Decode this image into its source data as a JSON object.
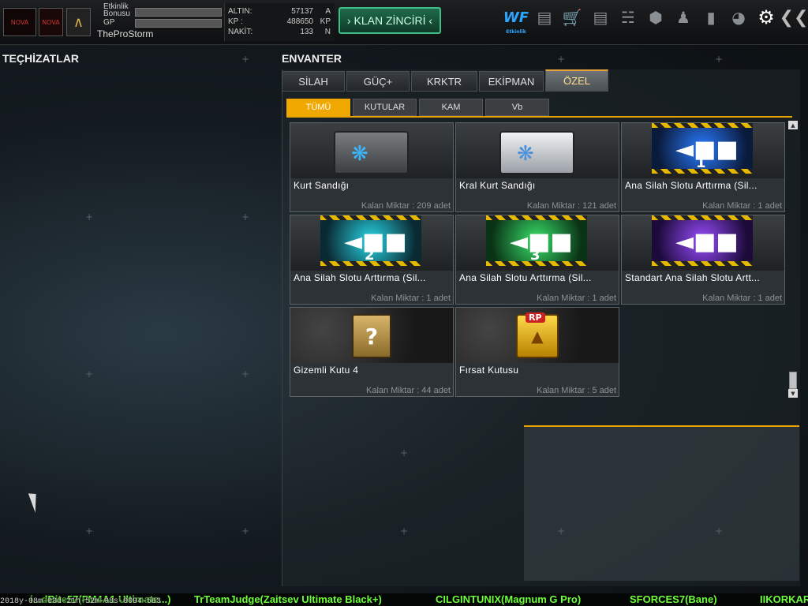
{
  "topbar": {
    "logo_main": "NOVA",
    "logo_small": "NOVA",
    "rank_icon": "rank-chevrons-icon",
    "event_bonus_line1": "Etkinlik",
    "event_bonus_line2": "Bonusu",
    "gp_label": "GP",
    "username": "TheProStorm",
    "event_bonus_progress": 0,
    "gp_progress": 0,
    "currency": [
      {
        "label": "ALTIN:",
        "value": "57137",
        "unit": "A"
      },
      {
        "label": "KP :",
        "value": "488650",
        "unit": "KP"
      },
      {
        "label": "NAKİT:",
        "value": "133",
        "unit": "N"
      }
    ],
    "clan_button": "KLAN ZİNCİRİ",
    "icons": [
      "etkinlik-icon",
      "ranking-icon",
      "shop-cart-icon",
      "inventory-briefcase-icon",
      "clan-icon",
      "capsule-box-icon",
      "friends-icon",
      "stats-icon",
      "globe-icon",
      "settings-gear-icon",
      "back-icon"
    ],
    "event_icon_text": "Etkinlik"
  },
  "left": {
    "title": "TEÇHİZATLAR"
  },
  "inventory": {
    "title": "ENVANTER",
    "tabs": [
      "SİLAH",
      "GÜÇ+",
      "KRKTR",
      "EKİPMAN",
      "ÖZEL"
    ],
    "active_tab": "ÖZEL",
    "subtabs": [
      "TÜMÜ",
      "KUTULAR",
      "KAM",
      "Vb"
    ],
    "active_subtab": "TÜMÜ",
    "items": [
      {
        "name": "Kurt Sandığı",
        "qty": "Kalan Miktar : 209 adet",
        "art": "chest-dark"
      },
      {
        "name": "Kral Kurt Sandığı",
        "qty": "Kalan Miktar : 121 adet",
        "art": "chest-silver"
      },
      {
        "name": "Ana Silah Slotu Arttırma (Sil...",
        "qty": "Kalan Miktar : 1 adet",
        "art": "slot-blue",
        "slot_num": "1"
      },
      {
        "name": "Ana Silah Slotu Arttırma (Sil...",
        "qty": "Kalan Miktar : 1 adet",
        "art": "slot-cyan",
        "slot_num": "2"
      },
      {
        "name": "Ana Silah Slotu Arttırma (Sil...",
        "qty": "Kalan Miktar : 1 adet",
        "art": "slot-green",
        "slot_num": "3"
      },
      {
        "name": "Standart Ana Silah Slotu Artt...",
        "qty": "Kalan Miktar : 1 adet",
        "art": "slot-purple",
        "slot_num": ""
      },
      {
        "name": "Gizemli Kutu 4",
        "qty": "Kalan Miktar : 44 adet",
        "art": "mystery-box"
      },
      {
        "name": "Fırsat Kutusu",
        "qty": "Kalan Miktar : 5 adet",
        "art": "opportunity-box",
        "badge": "RP"
      }
    ],
    "scroll_position": 0.95
  },
  "ticker": [
    "i...dBite57(FM4A1 Ultimate...)",
    "TrTeamJudge(Zaitsev Ultimate Black+)",
    "CILGINTUNIX(Magnum G Pro)",
    "SFORCES7(Bane)",
    "IIKORKAR"
  ],
  "timestamp": "2018y-08m-03d-21h-52m-08s-0094-563",
  "colors": {
    "accent_orange": "#e8a200",
    "clan_green": "#3fbf87",
    "ticker_green": "#6cff3a"
  }
}
